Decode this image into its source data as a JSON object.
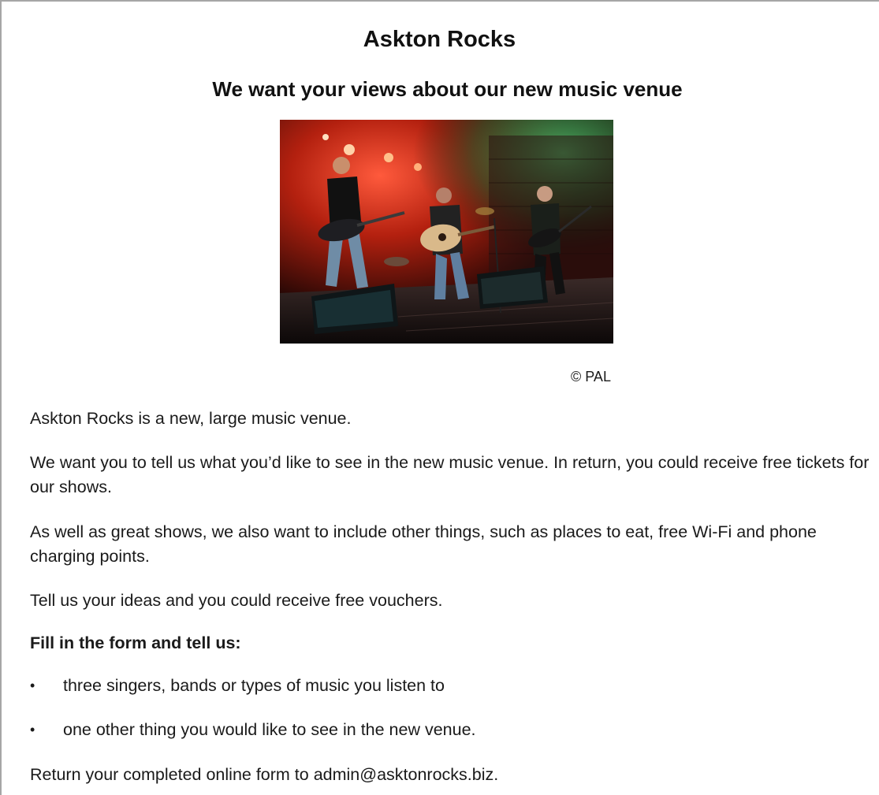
{
  "header": {
    "title": "Askton Rocks",
    "subtitle": "We want your views about our new music venue"
  },
  "image": {
    "alt": "band-on-stage-photo",
    "credit": "© PAL"
  },
  "body": {
    "p1": "Askton Rocks is a new, large music venue.",
    "p2": "We want you to tell us what you’d like to see in the new music venue. In return, you could receive free tickets for our shows.",
    "p3": "As well as great shows, we also want to include other things, such as places to eat, free Wi-Fi and phone charging points.",
    "p4": "Tell us your ideas and you could receive free vouchers.",
    "form_heading": "Fill in the form and tell us:",
    "bullets": [
      {
        "marker": "•",
        "text": "three singers, bands or types of music you listen to"
      },
      {
        "marker": "•",
        "text": "one other thing you would like to see in the new venue."
      }
    ],
    "closing": "Return your completed online form to admin@asktonrocks.biz."
  }
}
